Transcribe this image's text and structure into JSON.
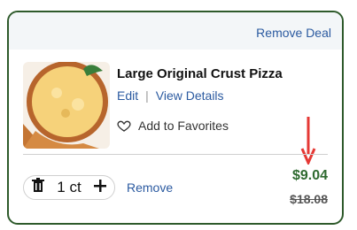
{
  "header": {
    "remove_deal": "Remove Deal"
  },
  "item": {
    "title": "Large Original Crust Pizza",
    "edit": "Edit",
    "view_details": "View Details",
    "favorites": "Add to Favorites"
  },
  "quantity": {
    "value": "1 ct"
  },
  "actions": {
    "remove": "Remove"
  },
  "price": {
    "current": "$9.04",
    "original": "$18.08"
  },
  "colors": {
    "accent": "#2b5aa0",
    "price": "#2e6a2f",
    "arrow": "#e53935",
    "border": "#2e5a2b"
  },
  "icons": {
    "trash": "trash-icon",
    "plus": "plus-icon",
    "heart": "heart-outline-icon",
    "arrow": "down-arrow"
  }
}
